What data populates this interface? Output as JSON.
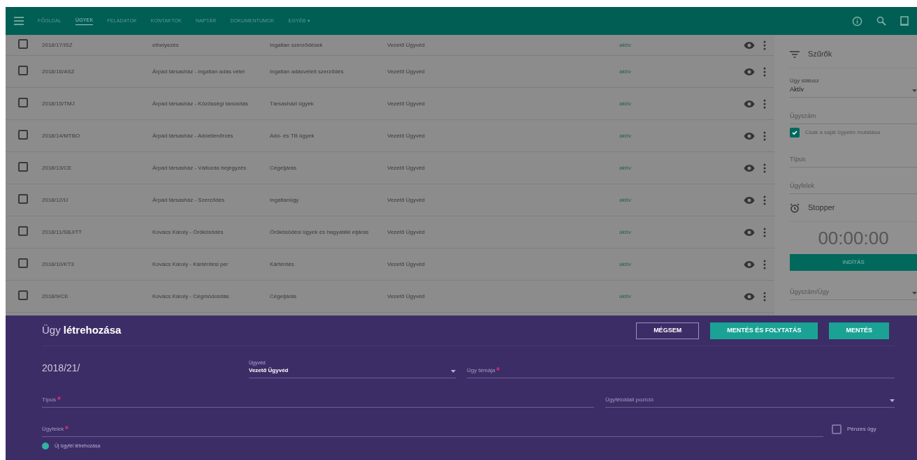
{
  "nav": {
    "items": [
      {
        "label": "FŐOLDAL",
        "selected": false
      },
      {
        "label": "ÜGYEK",
        "selected": true
      },
      {
        "label": "FELADATOK",
        "selected": false
      },
      {
        "label": "KONTAKTOK",
        "selected": false
      },
      {
        "label": "NAPTÁR",
        "selected": false
      },
      {
        "label": "DOKUMENTUMOK",
        "selected": false
      },
      {
        "label": "EGYÉB ▾",
        "selected": false
      }
    ]
  },
  "table": {
    "rows": [
      {
        "checked": false,
        "code": "2018/17/ISZ",
        "title": "elhelyezés",
        "type": "Ingatlan szerződések",
        "lawyer": "Vezető Ügyvéd",
        "status": "aktív"
      },
      {
        "checked": false,
        "code": "2018/16/ASZ",
        "title": "Árpád társasház - ingatlan adás vétel",
        "type": "Ingatlan adásvételi szerződés",
        "lawyer": "Vezető Ügyvéd",
        "status": "aktív"
      },
      {
        "checked": false,
        "code": "2018/15/TMJ",
        "title": "Árpád társasház - Közösségi tanúsítás",
        "type": "Társasházi ügyek",
        "lawyer": "Vezető Ügyvéd",
        "status": "aktív"
      },
      {
        "checked": false,
        "code": "2018/14/MTBO",
        "title": "Árpád társasház - Adóellenőrzés",
        "type": "Adó- és TB ügyek",
        "lawyer": "Vezető Ügyvéd",
        "status": "aktív"
      },
      {
        "checked": false,
        "code": "2018/13/CE",
        "title": "Árpád társasház - Változás bejegyzés",
        "type": "Cégeljárás",
        "lawyer": "Vezető Ügyvéd",
        "status": "aktív"
      },
      {
        "checked": false,
        "code": "2018/12/IJ",
        "title": "Árpád társasház - Szerződés",
        "type": "Ingatlanügy",
        "lawyer": "Vezető Ügyvéd",
        "status": "aktív"
      },
      {
        "checked": false,
        "code": "2018/11/SBJ/TT",
        "title": "Kovács Károly - Örökösödés",
        "type": "Örökösödési ügyek és hagyatéki eljárás",
        "lawyer": "Vezető Ügyvéd",
        "status": "aktív"
      },
      {
        "checked": false,
        "code": "2018/10/KT3",
        "title": "Kovács Károly - Kártérítési per",
        "type": "Kártérítés",
        "lawyer": "Vezető Ügyvéd",
        "status": "aktív"
      },
      {
        "checked": false,
        "code": "2018/9/CE",
        "title": "Kovács Károly - Cégmódosítás",
        "type": "Cégeljárás",
        "lawyer": "Vezető Ügyvéd",
        "status": "aktív"
      }
    ]
  },
  "sidebar": {
    "items": [
      {
        "kind": "filters",
        "label": "Szűrők"
      },
      {
        "kind": "select",
        "label": "Ügy státusz",
        "value": "Aktív"
      },
      {
        "kind": "field",
        "placeholder": "Ügyszám"
      },
      {
        "kind": "checkbox",
        "label": "Csak a saját ügyeim mutatása",
        "checked": true
      },
      {
        "kind": "field",
        "placeholder": "Típus"
      },
      {
        "kind": "field",
        "placeholder": "Ügyfelek"
      },
      {
        "kind": "stopwatch",
        "label": "Stopper"
      },
      {
        "kind": "timer",
        "value": "00:00:00"
      },
      {
        "kind": "button",
        "label": "INDÍTÁS"
      },
      {
        "kind": "select",
        "placeholder": "Ügyszám/Ügy"
      }
    ]
  },
  "dialog": {
    "title": "Ügy **létrehozása**",
    "buttons": [
      {
        "label": "MÉGSEM",
        "kind": "outline"
      },
      {
        "label": "MENTÉS ÉS FOLYTATÁS",
        "kind": "filled"
      },
      {
        "label": "MENTÉS",
        "kind": "filled"
      }
    ],
    "number": "2018/21/",
    "lawyer_select": {
      "label": "Ügyvéd",
      "value": "Vezető Ügyvéd"
    },
    "subject_field": {
      "placeholder": "Ügy témája",
      "required": true
    },
    "type_field": {
      "placeholder": "Típus",
      "required": true
    },
    "position_select": {
      "placeholder": "Ügyféloldali pozíció"
    },
    "clients_field": {
      "placeholder": "Ügyfelek",
      "required": true
    },
    "paid_checkbox": {
      "label": "Pénzes ügy",
      "checked": false
    },
    "new_client_radio": {
      "label": "Új ügyfél létrehozása",
      "selected": true
    }
  }
}
